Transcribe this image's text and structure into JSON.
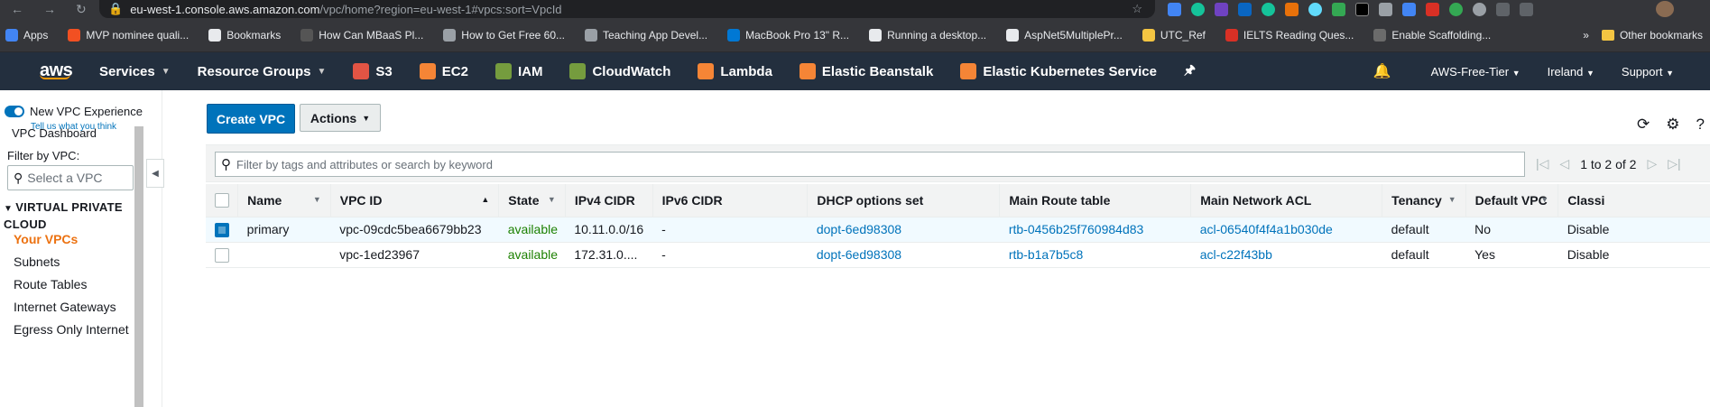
{
  "browser": {
    "url_host": "eu-west-1.console.aws.amazon.com",
    "url_path": "/vpc/home?region=eu-west-1#vpcs:sort=VpcId",
    "bookmarks": [
      {
        "label": "Apps",
        "color": "#4285f4"
      },
      {
        "label": "MVP nominee quali...",
        "color": "#f25022"
      },
      {
        "label": "Bookmarks",
        "color": "#e8eaed"
      },
      {
        "label": "How Can MBaaS Pl...",
        "color": "#555"
      },
      {
        "label": "How to Get Free 60...",
        "color": "#9aa0a6"
      },
      {
        "label": "Teaching App Devel...",
        "color": "#9aa0a6"
      },
      {
        "label": "MacBook Pro 13\" R...",
        "color": "#0078d4"
      },
      {
        "label": "Running a desktop...",
        "color": "#e8eaed"
      },
      {
        "label": "AspNet5MultiplePr...",
        "color": "#e8eaed"
      },
      {
        "label": "UTC_Ref",
        "color": "#f4c542"
      },
      {
        "label": "IELTS Reading Ques...",
        "color": "#d93025"
      },
      {
        "label": "Enable Scaffolding...",
        "color": "#6b6b6b"
      }
    ],
    "bookmarks_more": "»",
    "other_bookmarks": "Other bookmarks"
  },
  "aws_nav": {
    "logo": "aws",
    "items": [
      {
        "label": "Services",
        "chevron": true,
        "icon_color": ""
      },
      {
        "label": "Resource Groups",
        "chevron": true,
        "icon_color": ""
      },
      {
        "label": "S3",
        "chevron": false,
        "icon_color": "#e25444"
      },
      {
        "label": "EC2",
        "chevron": false,
        "icon_color": "#f58536"
      },
      {
        "label": "IAM",
        "chevron": false,
        "icon_color": "#759c3e"
      },
      {
        "label": "CloudWatch",
        "chevron": false,
        "icon_color": "#759c3e"
      },
      {
        "label": "Lambda",
        "chevron": false,
        "icon_color": "#f58536"
      },
      {
        "label": "Elastic Beanstalk",
        "chevron": false,
        "icon_color": "#f58536"
      },
      {
        "label": "Elastic Kubernetes Service",
        "chevron": false,
        "icon_color": "#f58536"
      }
    ],
    "account": "AWS-Free-Tier",
    "region": "Ireland",
    "support": "Support"
  },
  "sidebar": {
    "new_experience": "New VPC Experience",
    "tell_us": "Tell us what you think",
    "dashboard": "VPC Dashboard",
    "filter_label": "Filter by VPC:",
    "select_placeholder": "Select a VPC",
    "section": "VIRTUAL PRIVATE CLOUD",
    "items": [
      "Your VPCs",
      "Subnets",
      "Route Tables",
      "Internet Gateways",
      "Egress Only Internet"
    ]
  },
  "toolbar": {
    "create": "Create VPC",
    "actions": "Actions"
  },
  "search": {
    "placeholder": "Filter by tags and attributes or search by keyword",
    "pager_text": "1 to 2 of 2"
  },
  "table": {
    "columns": [
      "Name",
      "VPC ID",
      "State",
      "IPv4 CIDR",
      "IPv6 CIDR",
      "DHCP options set",
      "Main Route table",
      "Main Network ACL",
      "Tenancy",
      "Default VPC",
      "Classi"
    ],
    "rows": [
      {
        "selected": true,
        "name": "primary",
        "vpc_id": "vpc-09cdc5bea6679bb23",
        "state": "available",
        "ipv4": "10.11.0.0/16",
        "ipv6": "-",
        "dhcp": "dopt-6ed98308",
        "route_table": "rtb-0456b25f760984d83",
        "acl": "acl-06540f4f4a1b030de",
        "tenancy": "default",
        "default_vpc": "No",
        "classic": "Disable"
      },
      {
        "selected": false,
        "name": "",
        "vpc_id": "vpc-1ed23967",
        "state": "available",
        "ipv4": "172.31.0....",
        "ipv6": "-",
        "dhcp": "dopt-6ed98308",
        "route_table": "rtb-b1a7b5c8",
        "acl": "acl-c22f43bb",
        "tenancy": "default",
        "default_vpc": "Yes",
        "classic": "Disable"
      }
    ]
  }
}
